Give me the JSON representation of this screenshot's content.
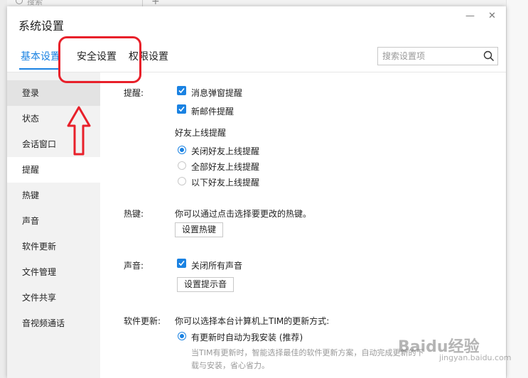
{
  "background": {
    "search_label": "搜索"
  },
  "window": {
    "title": "系统设置"
  },
  "tabs": [
    {
      "label": "基本设置",
      "active": true
    },
    {
      "label": "安全设置",
      "active": false
    },
    {
      "label": "权限设置",
      "active": false
    }
  ],
  "search": {
    "placeholder": "搜索设置项"
  },
  "sidebar": {
    "items": [
      {
        "label": "登录",
        "state": "selected"
      },
      {
        "label": "状态"
      },
      {
        "label": "会话窗口"
      },
      {
        "label": "提醒",
        "state": "current"
      },
      {
        "label": "热键"
      },
      {
        "label": "声音"
      },
      {
        "label": "软件更新"
      },
      {
        "label": "文件管理"
      },
      {
        "label": "文件共享"
      },
      {
        "label": "音视频通话"
      }
    ]
  },
  "remind": {
    "label": "提醒:",
    "popup": {
      "label": "消息弹窗提醒",
      "checked": true
    },
    "mail": {
      "label": "新邮件提醒",
      "checked": true
    },
    "friend_online": {
      "title": "好友上线提醒",
      "options": [
        {
          "label": "关闭好友上线提醒",
          "selected": true
        },
        {
          "label": "全部好友上线提醒",
          "selected": false
        },
        {
          "label": "以下好友上线提醒",
          "selected": false
        }
      ]
    }
  },
  "hotkey": {
    "label": "热键:",
    "desc": "你可以通过点击选择要更改的热键。",
    "button": "设置热键"
  },
  "sound": {
    "label": "声音:",
    "mute": {
      "label": "关闭所有声音",
      "checked": true
    },
    "button": "设置提示音"
  },
  "update": {
    "label": "软件更新:",
    "desc": "你可以选择本台计算机上TIM的更新方式:",
    "option": {
      "label": "有更新时自动为我安装 (推荐)",
      "selected": true
    },
    "detail_line1": "当TIM有更新时，智能选择最佳的软件更新方案，自动完成更新的下",
    "detail_line2": "载与安装，省心省力。"
  },
  "watermark": {
    "brand": "Baidu经验",
    "sub": "jingyan.baidu.com"
  },
  "colors": {
    "accent": "#1a82e2",
    "annotation": "#e8202a"
  }
}
